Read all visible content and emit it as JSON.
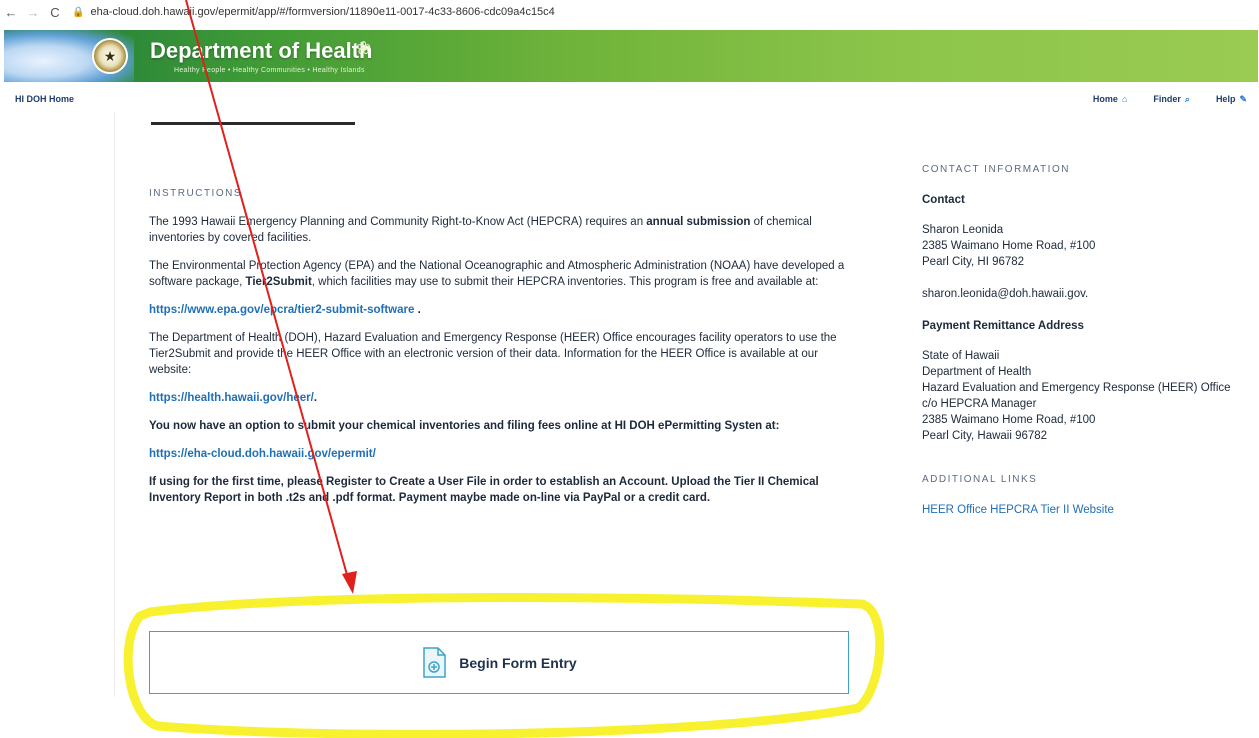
{
  "browser": {
    "back": "←",
    "forward": "→",
    "reload": "C",
    "lock": "🔒",
    "url": "eha-cloud.doh.hawaii.gov/epermit/app/#/formversion/11890e11-0017-4c33-8606-cdc09a4c15c4"
  },
  "banner": {
    "title": "Department of Health",
    "tagline": "Healthy People • Healthy Communities • Healthy Islands"
  },
  "topnav": {
    "home_link": "HI DOH Home",
    "links": [
      {
        "label": "Home",
        "icon": "home-icon",
        "glyph": "⌂"
      },
      {
        "label": "Finder",
        "icon": "search-icon",
        "glyph": "⌕"
      },
      {
        "label": "Help",
        "icon": "help-icon",
        "glyph": "✎"
      }
    ]
  },
  "main": {
    "section_label": "INSTRUCTIONS",
    "p1_pre": "The 1993 Hawaii Emergency Planning and Community Right-to-Know Act (HEPCRA) requires an ",
    "p1_bold": "annual submission",
    "p1_post": " of chemical inventories by covered facilities.",
    "p2_pre": "The Environmental Protection Agency (EPA) and the National Oceanographic and Atmospheric Administration (NOAA) have developed a software package, ",
    "p2_bold": "Tier2Submit",
    "p2_post": ", which facilities may use to submit their HEPCRA inventories. This program is free and available at:",
    "link1": "https://www.epa.gov/epcra/tier2-submit-software",
    "link1_suffix": " .",
    "p3": "The Department of Health (DOH), Hazard Evaluation and Emergency Response (HEER) Office encourages facility operators to use the Tier2Submit and provide the HEER Office with an electronic version of their data.  Information for the HEER Office is available at our website:",
    "link2": "https://health.hawaii.gov/heer/",
    "link2_suffix": ".",
    "p4": "You now have an option to submit your chemical inventories and filing fees online at HI DOH ePermitting Systen at:",
    "link3": "https://eha-cloud.doh.hawaii.gov/epermit/",
    "p5": "If using for the first time, please Register to Create a User File in order to establish an Account.    Upload the Tier II Chemical Inventory Report in both .t2s and .pdf format.  Payment maybe made on-line via PayPal or a credit card.",
    "begin_button": "Begin Form Entry"
  },
  "sidebar": {
    "section_label": "CONTACT INFORMATION",
    "contact_heading": "Contact",
    "contact_lines": [
      "Sharon Leonida",
      "2385 Waimano Home Road, #100",
      "Pearl City, HI 96782"
    ],
    "contact_email": "sharon.leonida@doh.hawaii.gov.",
    "payment_heading": "Payment Remittance Address",
    "payment_lines": [
      "State of Hawaii",
      "Department of Health",
      "Hazard Evaluation and Emergency Response (HEER) Office",
      "c/o HEPCRA Manager",
      "2385 Waimano Home Road, #100",
      "Pearl City, Hawaii 96782"
    ],
    "additional_label": "ADDITIONAL LINKS",
    "additional_link": "HEER Office HEPCRA Tier II Website"
  },
  "colors": {
    "link": "#1f6fb6",
    "annotation_arrow": "#e0201c",
    "annotation_highlight": "#f6ef1a",
    "button_border": "#3ea3c8"
  }
}
